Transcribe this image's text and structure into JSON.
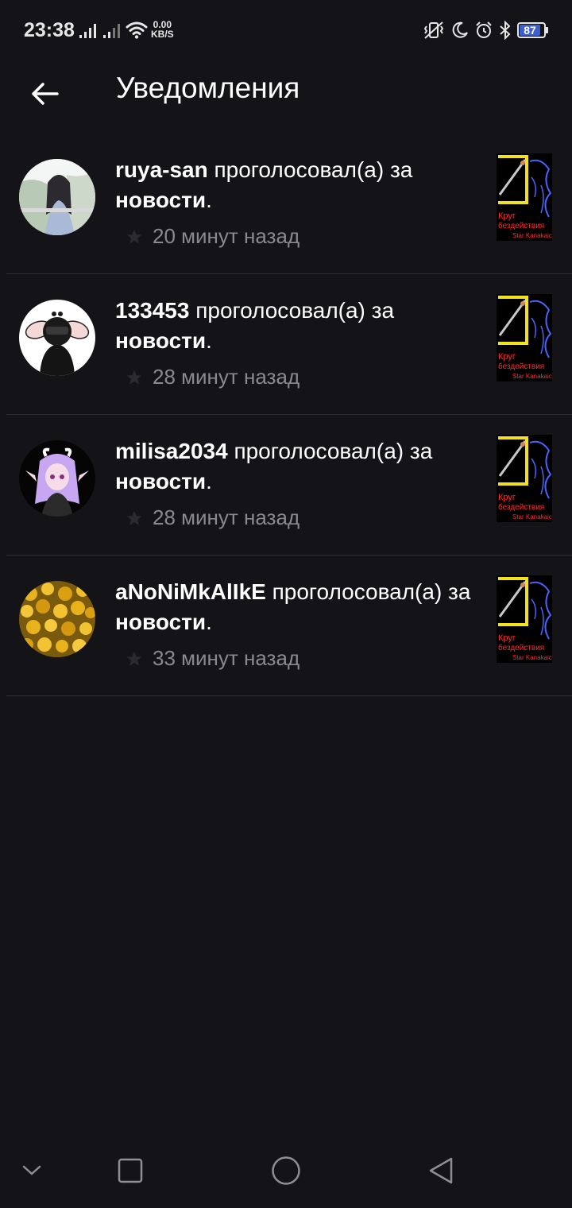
{
  "status_bar": {
    "time": "23:38",
    "net_speed_value": "0.00",
    "net_speed_unit": "KB/S",
    "battery_level": "87",
    "icons": [
      "signal-icon",
      "signal-icon",
      "wifi-icon",
      "vibrate-icon",
      "moon-icon",
      "alarm-icon",
      "bluetooth-icon",
      "battery-icon"
    ]
  },
  "header": {
    "back_icon": "arrow-left-icon",
    "title": "Уведомления"
  },
  "notifications": [
    {
      "user": "ruya-san",
      "action": " проголосовал(а) за ",
      "target": "новости",
      "tail": ".",
      "time": "20 минут назад"
    },
    {
      "user": "133453",
      "action": " проголосовал(а) за ",
      "target": "новости",
      "tail": ".",
      "time": "28 минут назад"
    },
    {
      "user": "milisa2034",
      "action": " проголосовал(а) за ",
      "target": "новости",
      "tail": ".",
      "time": "28 минут назад"
    },
    {
      "user": "aNoNiMkAlIkE",
      "action": " проголосовал(а) за ",
      "target": "новости",
      "tail": ".",
      "time": "33 минут назад"
    }
  ],
  "thumbnail_caption": [
    "Круг",
    "бездействия",
    "Star Kanakaic"
  ],
  "nav_bar": {
    "icons": [
      "chevron-down-icon",
      "square-icon",
      "circle-icon",
      "triangle-back-icon"
    ]
  },
  "colors": {
    "background": "#141317",
    "divider": "#2e2d33",
    "secondary_text": "#8a8990",
    "battery_accent": "#3b5fcf",
    "thumb_yellow": "#f3e21a",
    "thumb_blue": "#4a63ff",
    "thumb_red": "#ff2b2b"
  }
}
